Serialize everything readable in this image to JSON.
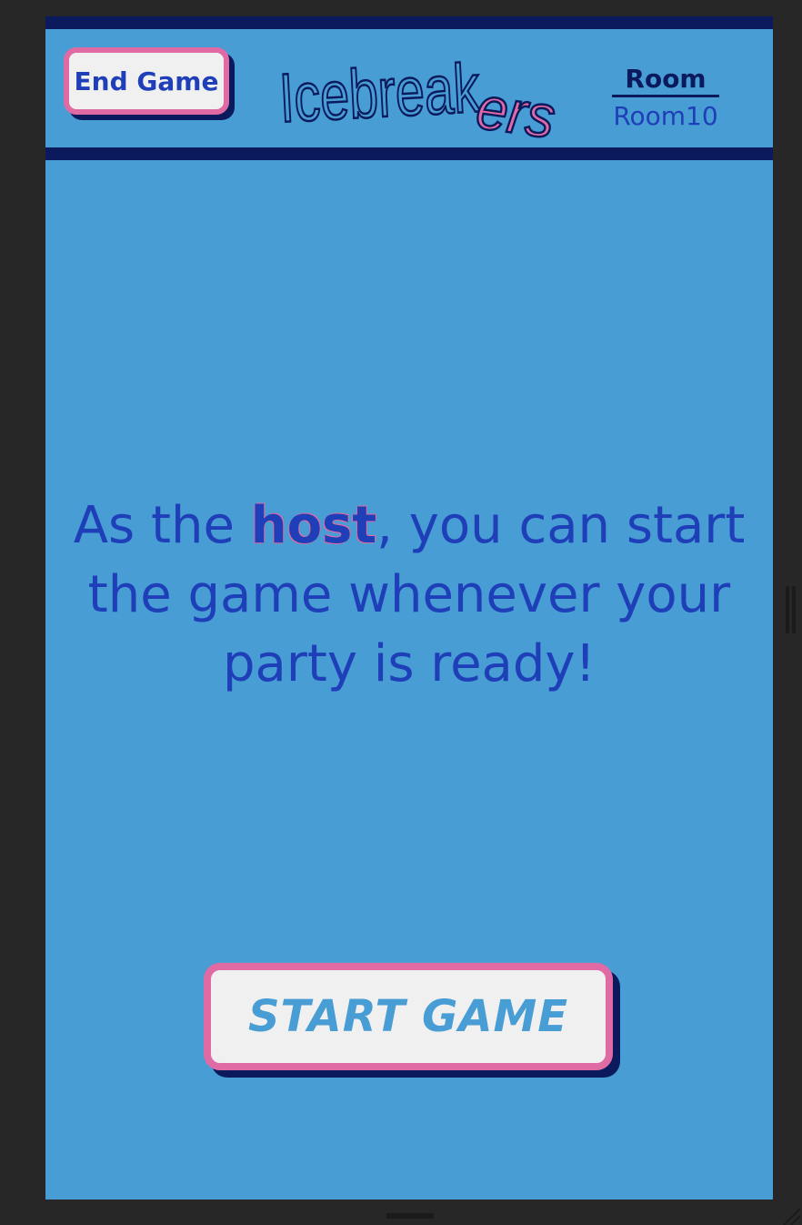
{
  "header": {
    "end_button_label": "End Game",
    "logo": {
      "main_text": "Icebreak",
      "accent_text": "ers"
    },
    "room": {
      "label": "Room",
      "value": "Room10"
    }
  },
  "main": {
    "message_before": "As the ",
    "message_emphasis": "host",
    "message_after": ", you can start the game whenever your party is ready!",
    "start_button_label": "START GAME"
  },
  "colors": {
    "background": "#479dd4",
    "navy": "#0a1a5c",
    "text_blue": "#1f3fb8",
    "pink": "#e06aa4",
    "button_fill": "#f0f0f0",
    "outer": "#272727"
  }
}
